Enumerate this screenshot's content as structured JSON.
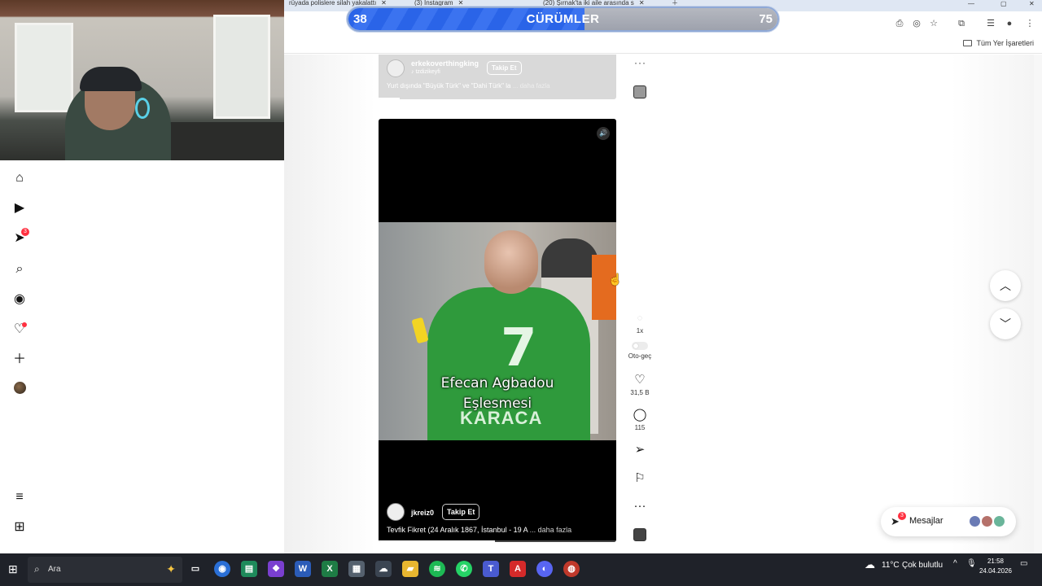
{
  "browser": {
    "tabs": [
      {
        "title": "rüyada polislere silah yakalattı"
      },
      {
        "title": "(3) Instagram"
      },
      {
        "title": "(20) Şırnak'ta iki aile arasında s"
      }
    ],
    "bookmarks_folder": "Tüm Yer İşaretleri"
  },
  "score_overlay": {
    "left_score": "38",
    "title": "CÜRÜMLER",
    "right_score": "75",
    "colors": {
      "left": "#2a64e8",
      "right": "#a9adb6"
    }
  },
  "left_nav": {
    "items": [
      {
        "icon": "home-icon"
      },
      {
        "icon": "reels-icon"
      },
      {
        "icon": "messages-icon",
        "badge": "3"
      },
      {
        "icon": "search-icon"
      },
      {
        "icon": "explore-icon"
      },
      {
        "icon": "notifications-icon"
      },
      {
        "icon": "create-icon"
      },
      {
        "icon": "profile-avatar"
      }
    ],
    "bottom": [
      {
        "icon": "menu-icon"
      },
      {
        "icon": "also-from-meta-icon"
      }
    ]
  },
  "reel_prev": {
    "username": "erkekoverthingking",
    "audio": "tzdizikeyfi",
    "follow": "Takip Et",
    "caption": "Yurt dışında \"Büyük Türk\" ve \"Dahi Türk\" la",
    "more": "... daha fazla"
  },
  "reel_current": {
    "overlay_line1": "Efecan Agbadou",
    "overlay_line2": "Eşlesmesi",
    "jersey_number": "7",
    "jersey_name": "KARACA",
    "username": "jkreiz0",
    "follow": "Takip Et",
    "caption": "Tevfik Fikret (24 Aralık 1867, İstanbul - 19 A",
    "more": "... daha fazla",
    "progress": 0.49
  },
  "side_actions": {
    "speed": "1x",
    "autoplay": "Oto-geç",
    "likes": "31,5 B",
    "comments": "115"
  },
  "messages": {
    "label": "Mesajlar",
    "badge": "3"
  },
  "taskbar": {
    "search": "Ara",
    "weather_temp": "11°C",
    "weather_desc": "Çok bulutlu",
    "time": "21:58",
    "date": "24.04.2026"
  }
}
